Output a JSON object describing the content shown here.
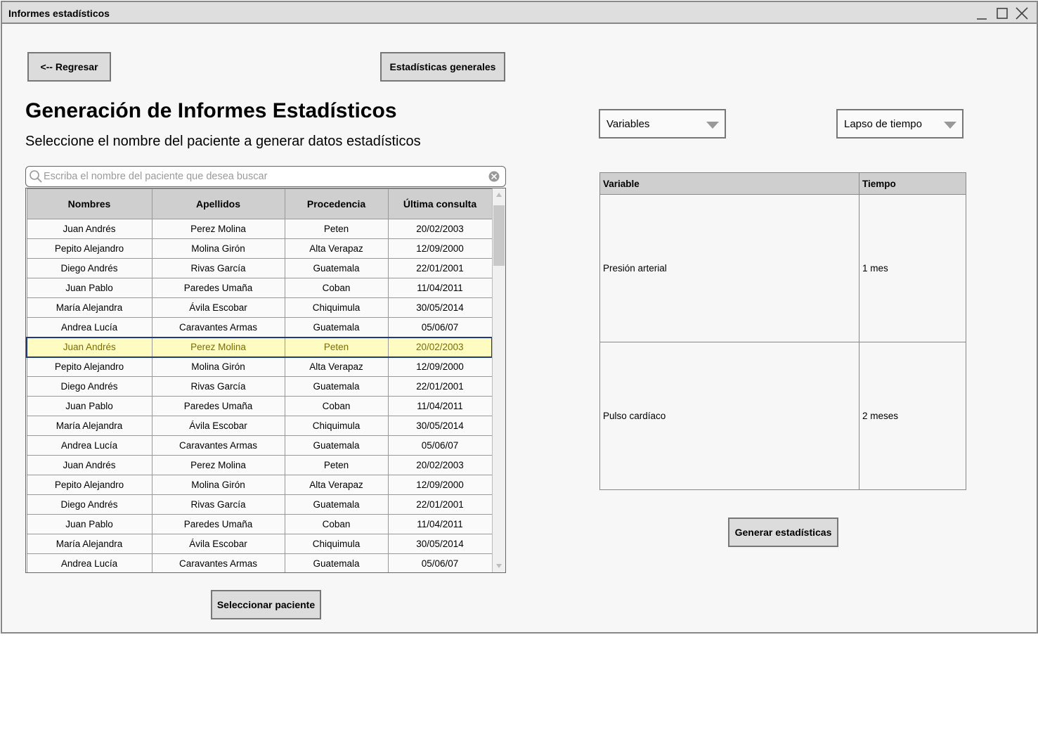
{
  "window": {
    "title": "Informes estadísticos"
  },
  "toolbar": {
    "back_label": "<-- Regresar",
    "general_stats_label": "Estadísticas generales"
  },
  "page": {
    "title": "Generación de Informes Estadísticos",
    "subtitle": "Seleccione el nombre del paciente a generar datos estadísticos"
  },
  "search": {
    "placeholder": "Escriba el nombre del paciente que desea buscar",
    "value": ""
  },
  "patients": {
    "columns": [
      "Nombres",
      "Apellidos",
      "Procedencia",
      "Última consulta"
    ],
    "selected_index": 6,
    "rows": [
      [
        "Juan Andrés",
        "Perez Molina",
        "Peten",
        "20/02/2003"
      ],
      [
        "Pepito Alejandro",
        "Molina Girón",
        "Alta Verapaz",
        "12/09/2000"
      ],
      [
        "Diego Andrés",
        "Rivas García",
        "Guatemala",
        "22/01/2001"
      ],
      [
        "Juan Pablo",
        "Paredes Umaña",
        "Coban",
        "11/04/2011"
      ],
      [
        "María Alejandra",
        "Ávila Escobar",
        "Chiquimula",
        "30/05/2014"
      ],
      [
        "Andrea Lucía",
        "Caravantes Armas",
        "Guatemala",
        "05/06/07"
      ],
      [
        "Juan Andrés",
        "Perez Molina",
        "Peten",
        "20/02/2003"
      ],
      [
        "Pepito Alejandro",
        "Molina Girón",
        "Alta Verapaz",
        "12/09/2000"
      ],
      [
        "Diego Andrés",
        "Rivas García",
        "Guatemala",
        "22/01/2001"
      ],
      [
        "Juan Pablo",
        "Paredes Umaña",
        "Coban",
        "11/04/2011"
      ],
      [
        "María Alejandra",
        "Ávila Escobar",
        "Chiquimula",
        "30/05/2014"
      ],
      [
        "Andrea Lucía",
        "Caravantes Armas",
        "Guatemala",
        "05/06/07"
      ],
      [
        "Juan Andrés",
        "Perez Molina",
        "Peten",
        "20/02/2003"
      ],
      [
        "Pepito Alejandro",
        "Molina Girón",
        "Alta Verapaz",
        "12/09/2000"
      ],
      [
        "Diego Andrés",
        "Rivas García",
        "Guatemala",
        "22/01/2001"
      ],
      [
        "Juan Pablo",
        "Paredes Umaña",
        "Coban",
        "11/04/2011"
      ],
      [
        "María Alejandra",
        "Ávila Escobar",
        "Chiquimula",
        "30/05/2014"
      ],
      [
        "Andrea Lucía",
        "Caravantes Armas",
        "Guatemala",
        "05/06/07"
      ]
    ],
    "select_button_label": "Seleccionar paciente"
  },
  "filters": {
    "variables": {
      "selected": "Variables"
    },
    "time_span": {
      "selected": "Lapso de tiempo"
    }
  },
  "variables_table": {
    "columns": [
      "Variable",
      "Tiempo"
    ],
    "rows": [
      [
        "Presión arterial",
        "1 mes"
      ],
      [
        "Pulso cardíaco",
        "2 meses"
      ]
    ]
  },
  "generate_button_label": "Generar estadísticas",
  "icons": {
    "minimize": "minimize-icon",
    "maximize": "maximize-icon",
    "close": "close-icon",
    "search": "search-icon",
    "clear": "clear-icon",
    "dropdown": "chevron-down-icon"
  }
}
